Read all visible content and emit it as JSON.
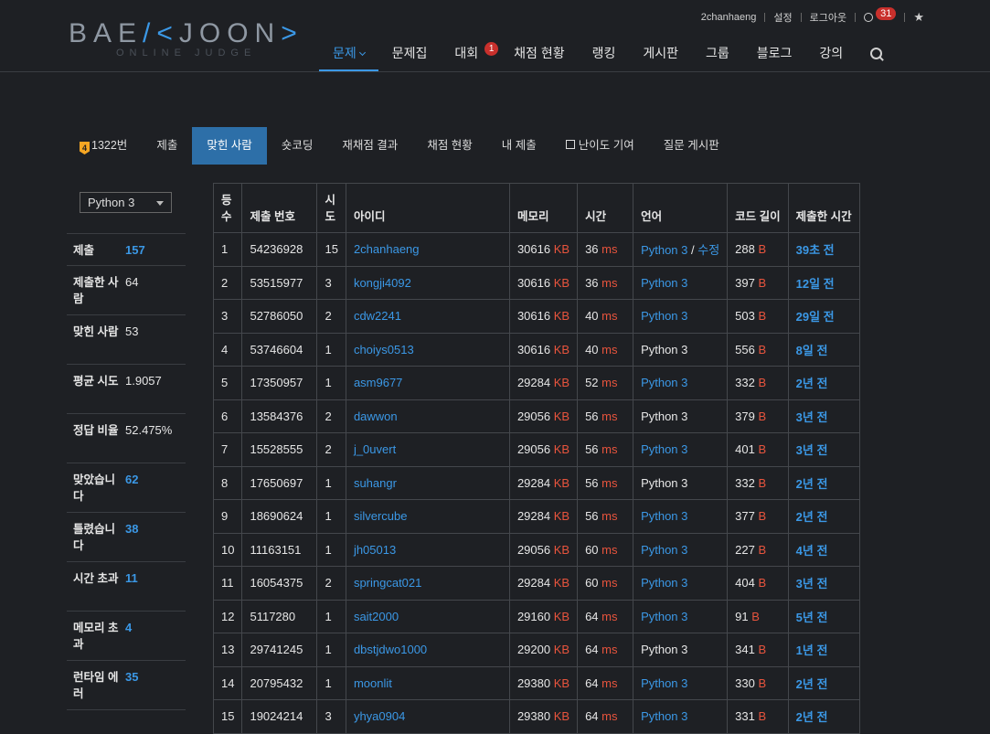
{
  "logo": {
    "left": "BAE",
    "accent": "/<",
    "right": "JOON",
    "accent2": ">",
    "sub": "ONLINE JUDGE"
  },
  "usernav": {
    "username": "2chanhaeng",
    "settings": "설정",
    "logout": "로그아웃",
    "notifications": "31"
  },
  "mainnav": {
    "items": [
      "문제",
      "문제집",
      "대회",
      "채점 현황",
      "랭킹",
      "게시판",
      "그룹",
      "블로그",
      "강의"
    ],
    "contest_badge": "1"
  },
  "problem_menu": {
    "tier": "4",
    "problem_number": "1322번",
    "tabs": [
      "제출",
      "맞힌 사람",
      "숏코딩",
      "재채점 결과",
      "채점 현황",
      "내 제출",
      "난이도 기여",
      "질문 게시판"
    ]
  },
  "sidebar": {
    "language_selected": "Python 3",
    "stats": [
      {
        "label": "제출",
        "value": "157",
        "link": true
      },
      {
        "label": "제출한 사람",
        "value": "64",
        "link": false
      },
      {
        "label": "맞힌 사람",
        "value": "53",
        "link": false
      },
      {
        "label": "평균 시도",
        "value": "1.9057",
        "link": false
      },
      {
        "label": "정답 비율",
        "value": "52.475%",
        "link": false
      },
      {
        "label": "맞았습니다",
        "value": "62",
        "link": true
      },
      {
        "label": "틀렸습니다",
        "value": "38",
        "link": true
      },
      {
        "label": "시간 초과",
        "value": "11",
        "link": true
      },
      {
        "label": "메모리 초과",
        "value": "4",
        "link": true
      },
      {
        "label": "런타임 에러",
        "value": "35",
        "link": true
      }
    ]
  },
  "table": {
    "headers": [
      "등수",
      "제출 번호",
      "시도",
      "아이디",
      "메모리",
      "시간",
      "언어",
      "코드 길이",
      "제출한 시간"
    ],
    "unit_memory": "KB",
    "unit_time": "ms",
    "unit_length": "B",
    "edit_label": "수정",
    "rows": [
      {
        "rank": "1",
        "submission": "54236928",
        "tries": "15",
        "user": "2chanhaeng",
        "memory": "30616",
        "time": "36",
        "lang": "Python 3",
        "lang_link": true,
        "editable": true,
        "length": "288",
        "submitted": "39초 전"
      },
      {
        "rank": "2",
        "submission": "53515977",
        "tries": "3",
        "user": "kongji4092",
        "memory": "30616",
        "time": "36",
        "lang": "Python 3",
        "lang_link": true,
        "editable": false,
        "length": "397",
        "submitted": "12일 전"
      },
      {
        "rank": "3",
        "submission": "52786050",
        "tries": "2",
        "user": "cdw2241",
        "memory": "30616",
        "time": "40",
        "lang": "Python 3",
        "lang_link": true,
        "editable": false,
        "length": "503",
        "submitted": "29일 전"
      },
      {
        "rank": "4",
        "submission": "53746604",
        "tries": "1",
        "user": "choiys0513",
        "memory": "30616",
        "time": "40",
        "lang": "Python 3",
        "lang_link": false,
        "editable": false,
        "length": "556",
        "submitted": "8일 전"
      },
      {
        "rank": "5",
        "submission": "17350957",
        "tries": "1",
        "user": "asm9677",
        "memory": "29284",
        "time": "52",
        "lang": "Python 3",
        "lang_link": true,
        "editable": false,
        "length": "332",
        "submitted": "2년 전"
      },
      {
        "rank": "6",
        "submission": "13584376",
        "tries": "2",
        "user": "dawwon",
        "memory": "29056",
        "time": "56",
        "lang": "Python 3",
        "lang_link": false,
        "editable": false,
        "length": "379",
        "submitted": "3년 전"
      },
      {
        "rank": "7",
        "submission": "15528555",
        "tries": "2",
        "user": "j_0uvert",
        "memory": "29056",
        "time": "56",
        "lang": "Python 3",
        "lang_link": true,
        "editable": false,
        "length": "401",
        "submitted": "3년 전"
      },
      {
        "rank": "8",
        "submission": "17650697",
        "tries": "1",
        "user": "suhangr",
        "memory": "29284",
        "time": "56",
        "lang": "Python 3",
        "lang_link": false,
        "editable": false,
        "length": "332",
        "submitted": "2년 전"
      },
      {
        "rank": "9",
        "submission": "18690624",
        "tries": "1",
        "user": "silvercube",
        "memory": "29284",
        "time": "56",
        "lang": "Python 3",
        "lang_link": true,
        "editable": false,
        "length": "377",
        "submitted": "2년 전"
      },
      {
        "rank": "10",
        "submission": "11163151",
        "tries": "1",
        "user": "jh05013",
        "memory": "29056",
        "time": "60",
        "lang": "Python 3",
        "lang_link": true,
        "editable": false,
        "length": "227",
        "submitted": "4년 전"
      },
      {
        "rank": "11",
        "submission": "16054375",
        "tries": "2",
        "user": "springcat021",
        "memory": "29284",
        "time": "60",
        "lang": "Python 3",
        "lang_link": true,
        "editable": false,
        "length": "404",
        "submitted": "3년 전"
      },
      {
        "rank": "12",
        "submission": "5117280",
        "tries": "1",
        "user": "sait2000",
        "memory": "29160",
        "time": "64",
        "lang": "Python 3",
        "lang_link": true,
        "editable": false,
        "length": "91",
        "submitted": "5년 전"
      },
      {
        "rank": "13",
        "submission": "29741245",
        "tries": "1",
        "user": "dbstjdwo1000",
        "memory": "29200",
        "time": "64",
        "lang": "Python 3",
        "lang_link": false,
        "editable": false,
        "length": "341",
        "submitted": "1년 전"
      },
      {
        "rank": "14",
        "submission": "20795432",
        "tries": "1",
        "user": "moonlit",
        "memory": "29380",
        "time": "64",
        "lang": "Python 3",
        "lang_link": true,
        "editable": false,
        "length": "330",
        "submitted": "2년 전"
      },
      {
        "rank": "15",
        "submission": "19024214",
        "tries": "3",
        "user": "yhya0904",
        "memory": "29380",
        "time": "64",
        "lang": "Python 3",
        "lang_link": true,
        "editable": false,
        "length": "331",
        "submitted": "2년 전"
      }
    ]
  },
  "colors": {
    "background": "#1e2024",
    "accent": "#3b98e6",
    "unit": "#e8543d",
    "active_tab": "#2d6fa8",
    "badge": "#c9302c"
  }
}
